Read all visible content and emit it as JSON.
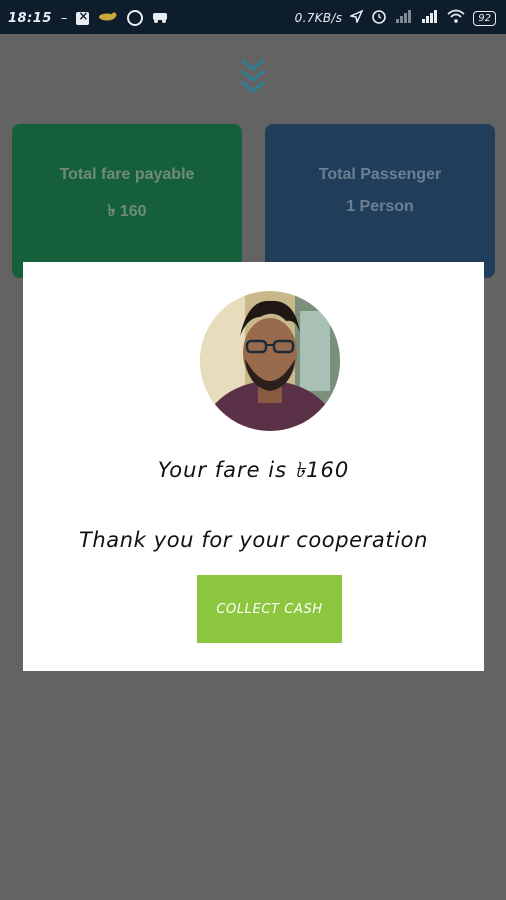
{
  "status_bar": {
    "time": "18:15",
    "net_speed": "0.7KB/s",
    "battery": "92"
  },
  "cards": {
    "fare": {
      "label": "Total fare payable",
      "value": "৳ 160"
    },
    "passenger": {
      "label": "Total Passenger",
      "value": "1  Person"
    }
  },
  "dialog": {
    "fare_text": "Your fare is ৳160",
    "thanks_text": "Thank you for your cooperation",
    "collect_label": "COLLECT CASH"
  },
  "colors": {
    "fare_card": "#15603a",
    "passenger_card": "#203e5a",
    "collect_button": "#8dc63f",
    "status_bar": "#0e1d2b"
  }
}
